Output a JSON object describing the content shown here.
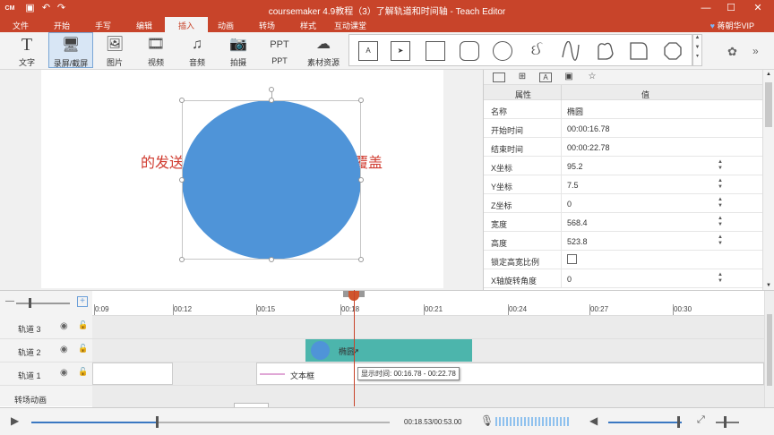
{
  "window": {
    "title": "coursemaker 4.9教程（3）了解轨道和时间轴 - Teach Editor",
    "logo": "CM"
  },
  "menu": {
    "items": [
      "文件",
      "开始",
      "手写",
      "编辑",
      "插入",
      "动画",
      "转场",
      "样式",
      "互动课堂"
    ],
    "active": "插入",
    "user": "蒋朝华VIP"
  },
  "ribbon": {
    "buttons": [
      {
        "label": "文字",
        "icon": "T"
      },
      {
        "label": "录屏/截屏",
        "icon": "🖥"
      },
      {
        "label": "图片",
        "icon": "🖼"
      },
      {
        "label": "视频",
        "icon": "🎞"
      },
      {
        "label": "音频",
        "icon": "♫"
      },
      {
        "label": "拍摄",
        "icon": "📷"
      },
      {
        "label": "PPT",
        "icon": "PPT"
      },
      {
        "label": "素材资源",
        "icon": "☁"
      }
    ]
  },
  "canvas": {
    "left_text": "的发送",
    "right_text": "覆盖"
  },
  "properties": {
    "col_name": "属性",
    "col_value": "值",
    "rows": [
      {
        "k": "名称",
        "v": "椭圆"
      },
      {
        "k": "开始时间",
        "v": "00:00:16.78"
      },
      {
        "k": "结束时间",
        "v": "00:00:22.78"
      },
      {
        "k": "X坐标",
        "v": "95.2"
      },
      {
        "k": "Y坐标",
        "v": "7.5"
      },
      {
        "k": "Z坐标",
        "v": "0"
      },
      {
        "k": "宽度",
        "v": "568.4"
      },
      {
        "k": "高度",
        "v": "523.8"
      },
      {
        "k": "锁定高宽比例",
        "v": ""
      },
      {
        "k": "X轴旋转角度",
        "v": "0"
      }
    ]
  },
  "timeline": {
    "ticks": [
      "0:09",
      "00:12",
      "00:15",
      "00:18",
      "00:21",
      "00:24",
      "00:27",
      "00:30"
    ],
    "tracks": [
      "轨道 3",
      "轨道 2",
      "轨道 1",
      "转场动画"
    ],
    "clip_ellipse": "椭圆",
    "clip_textbox": "文本框",
    "tooltip": "显示时间: 00:16.78 - 00:22.78"
  },
  "playback": {
    "time": "00:18.53/00:53.00"
  },
  "colors": {
    "accent": "#c8442a",
    "ellipse": "#4f94d8",
    "clip": "#4cb5ac"
  }
}
